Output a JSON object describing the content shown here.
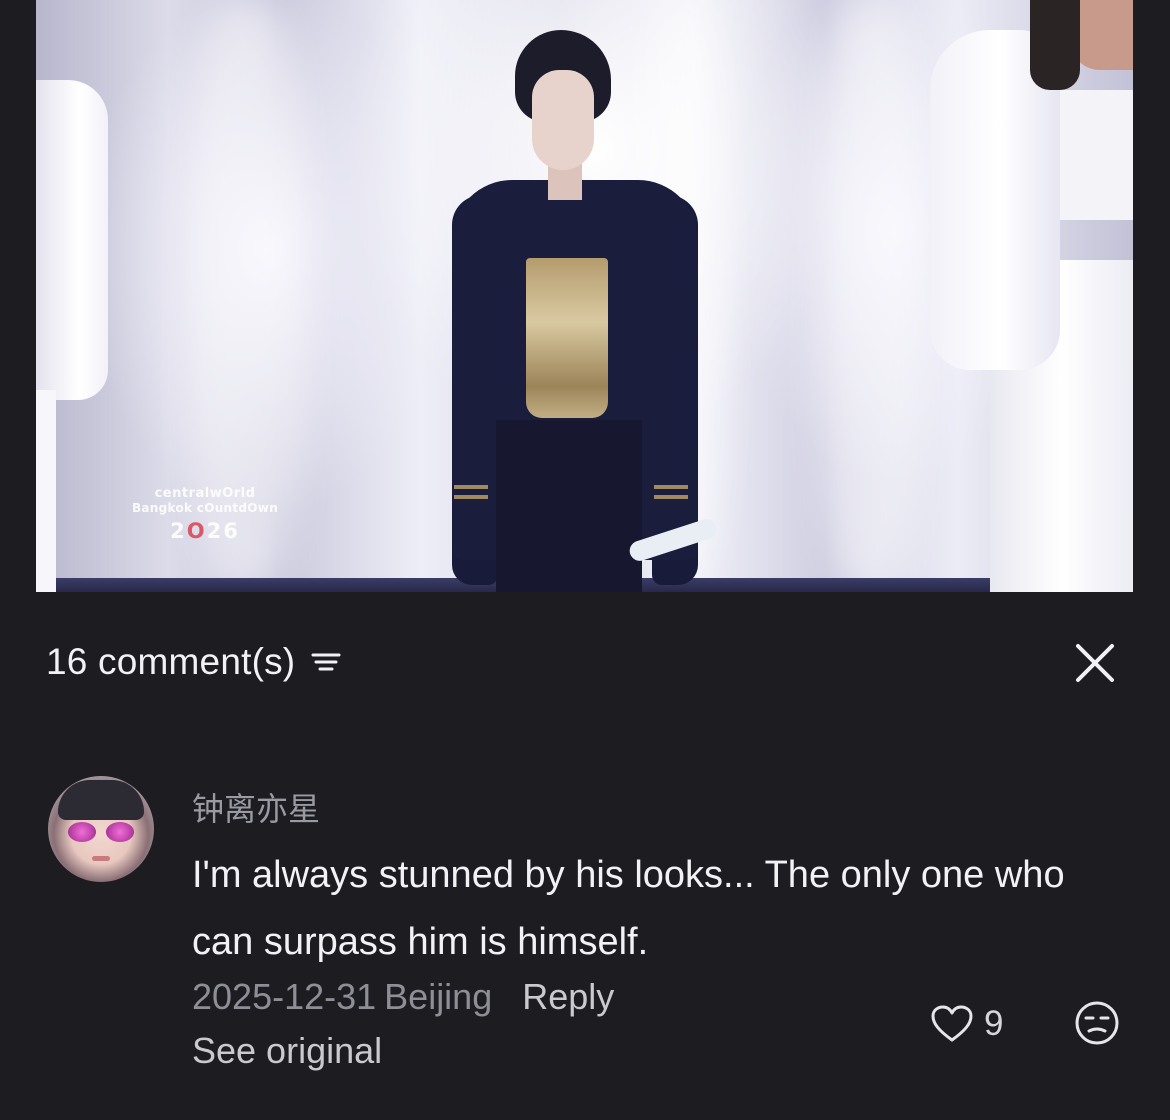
{
  "video": {
    "watermark": {
      "line1": "centralwOrld",
      "line2": "Bangkok cOuntdOwn",
      "year_a": "2",
      "year_o": "O",
      "year_b": "26"
    }
  },
  "comments_panel": {
    "count_label": "16 comment(s)",
    "sort_icon": "filter-lines-icon",
    "close_icon": "close-x-icon"
  },
  "comment": {
    "username": "钟离亦星",
    "text": "I'm always stunned by his looks... The only one who can surpass him is himself.",
    "date": "2025-12-31",
    "location": "Beijing",
    "reply_label": "Reply",
    "see_original_label": "See original",
    "like_count": "9",
    "like_icon": "heart-outline-icon",
    "dislike_icon": "unamused-face-icon"
  },
  "colors": {
    "sheet_background": "#1c1c21",
    "primary_text": "#f2f2f4",
    "secondary_text": "#8e8e96",
    "watermark_accent": "#d94a5a"
  }
}
